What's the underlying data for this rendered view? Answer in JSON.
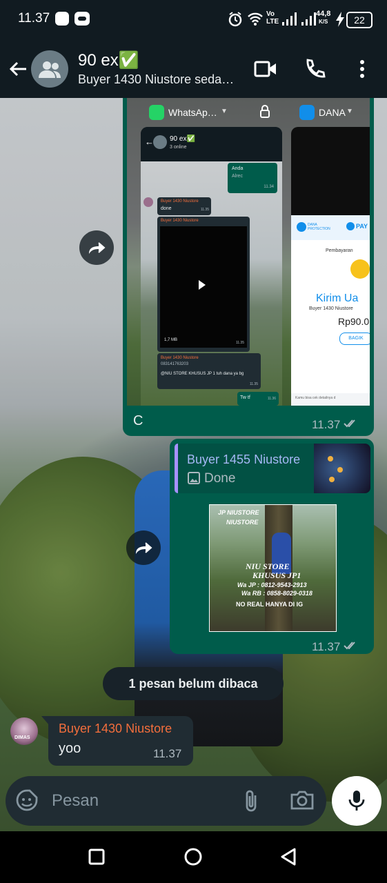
{
  "status_bar": {
    "time": "11.37",
    "network_speed": "44,8",
    "network_speed_unit": "K/S",
    "volte": "Vo",
    "lte": "LTE",
    "battery": "22"
  },
  "header": {
    "title": "90 ex✅",
    "subtitle": "Buyer 1430 Niustore seda…"
  },
  "messages": {
    "forwarded_screenshot": {
      "caption": "C",
      "time": "11.37",
      "inner": {
        "app_switcher_left": "WhatsAp…",
        "app_switcher_right": "DANA",
        "chat_title": "90 ex✅",
        "chat_sub": "3 online",
        "msg_anda_name": "Anda",
        "msg_anda_text": "Alrec",
        "msg_anda_time": "11.34",
        "buyer_name": "Buyer 1430 Niustore",
        "buyer_text": "done",
        "buyer_time": "11.35",
        "video_sender": "Buyer 1430 Niustore",
        "video_size": "1,7 MB",
        "video_time": "11.35",
        "reply_name": "Buyer 1430 Niustore",
        "reply_number": "083141763203",
        "reply_text": "@NIU STORE KHUSUS JP 1 tuh dana ya bg",
        "reply_time": "11.35",
        "tw_text": "Tw tf",
        "tw_time": "11.36",
        "dana_protection": "DANA PROTECTION",
        "pay_label": "PAY",
        "pembayaran": "Pembayaran",
        "kirim": "Kirim Ua",
        "dana_to": "Buyer 1430 Niustore",
        "dana_amount": "Rp90.0",
        "bagikan": "BAGIK",
        "dana_footer": "Kamu bisa cek detailnya d"
      }
    },
    "reply_image": {
      "quote_sender": "Buyer 1455 Niustore",
      "quote_text": "Done",
      "time": "11.37",
      "poster": {
        "line1": "JP NIUSTORE",
        "line2": "NIUSTORE",
        "line3": "NIU STORE",
        "line4": "KHUSUS JP1",
        "wa_jp": "Wa JP : 0812-9543-2913",
        "wa_rb": "Wa RB : 0858-8029-0318",
        "footer": "NO REAL HANYA DI IG"
      }
    },
    "unread": "1 pesan belum dibaca",
    "incoming": {
      "sender": "Buyer 1430 Niustore",
      "text": "yoo",
      "time": "11.37",
      "avatar_text": "DIMAS"
    }
  },
  "composer": {
    "placeholder": "Pesan"
  },
  "colors": {
    "outgoing_bubble": "#005c4b",
    "incoming_bubble": "#202c33",
    "header_bg": "#111b21",
    "sender_orange": "#f36e3c",
    "quote_bar": "#a791ff"
  },
  "icons": [
    "back-arrow-icon",
    "group-avatar-icon",
    "video-call-icon",
    "phone-icon",
    "more-vert-icon",
    "forward-icon",
    "image-icon",
    "double-check-icon",
    "emoji-icon",
    "attach-icon",
    "camera-icon",
    "mic-icon",
    "nav-back-icon",
    "nav-home-icon",
    "nav-recents-icon"
  ]
}
